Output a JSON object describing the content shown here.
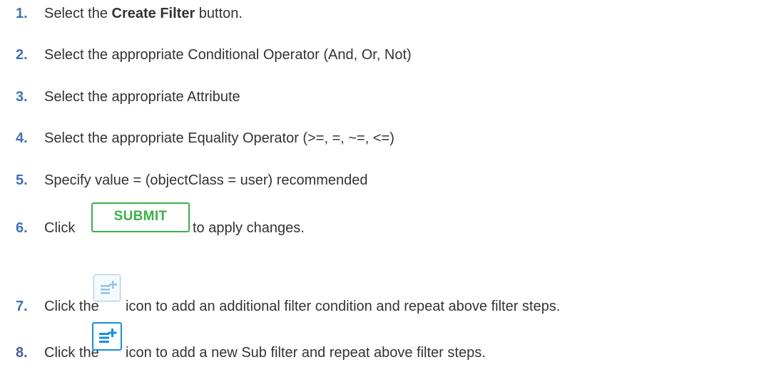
{
  "theme": {
    "number_color": "#3f71b8",
    "number_color_alt": "#4a5b9c",
    "text_color": "#333333",
    "submit_color": "#3cb04a",
    "icon_blue": "#1590e1",
    "icon_blue_light": "#8fc3ea"
  },
  "steps": [
    {
      "num": "1.",
      "before": "Select the ",
      "bold": "Create Filter",
      "after": " button."
    },
    {
      "num": "2.",
      "text": "Select the appropriate Conditional Operator (And, Or, Not)"
    },
    {
      "num": "3.",
      "text": "Select the appropriate Attribute"
    },
    {
      "num": "4.",
      "text": "Select the appropriate Equality Operator (>=, =, ~=, <=)"
    },
    {
      "num": "5.",
      "text": "Specify value = (objectClass = user) recommended"
    },
    {
      "num": "6.",
      "before": "Click",
      "button": "SUBMIT",
      "after": "to apply changes."
    },
    {
      "num": "7.",
      "before": "Click the",
      "after": "icon to add an additional filter condition and repeat above filter steps.",
      "icon": "add-filter-condition-icon"
    },
    {
      "num": "8.",
      "before": "Click the",
      "after": "icon to add a new Sub filter and repeat above filter steps.",
      "icon": "add-sub-filter-icon"
    }
  ]
}
